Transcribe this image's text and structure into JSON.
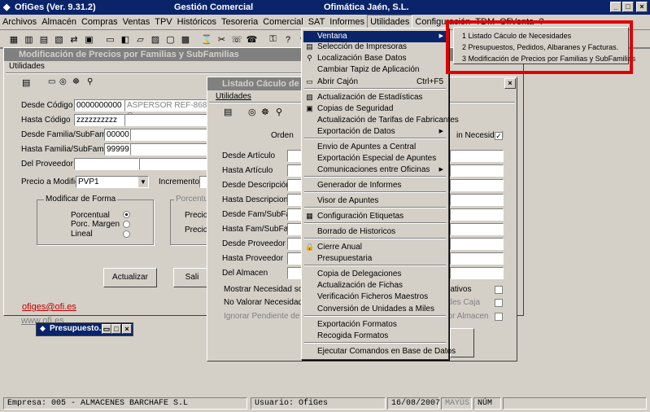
{
  "app": {
    "title": "OfiGes (Ver. 9.31.2)",
    "center_title": "Gestión Comercial",
    "company": "Ofimática Jaén, S.L."
  },
  "menubar": [
    "Archivos",
    "Almacén",
    "Compras",
    "Ventas",
    "TPV",
    "Históricos",
    "Tesoreria",
    "Comercial",
    "SAT",
    "Informes",
    "Utilidades",
    "Configuración",
    "TDM",
    "OfiVenta",
    "?"
  ],
  "menu_utilidades": [
    "Ventana",
    "Selección de Impresoras",
    "Localización Base Datos",
    "Cambiar Tapiz de Aplicación",
    "Abrir Cajón",
    "Actualización de Estadísticas",
    "Copias de Seguridad",
    "Actualización de Tarifas de Fabricantes",
    "Exportación de Datos",
    "Envio de Apuntes a Central",
    "Exportación Especial de Apuntes",
    "Comunicaciones entre Oficinas",
    "Generador de Informes",
    "Visor de Apuntes",
    "Configuración Etiquetas",
    "Borrado de Historicos",
    "Cierre Anual",
    "Presupuestaria",
    "Copia de Delegaciones",
    "Actualización de Fichas",
    "Verificación Ficheros Maestros",
    "Conversión de Unidades a Miles",
    "Exportación Formatos",
    "Recogida Formatos",
    "Ejecutar Comandos en Base de Datos"
  ],
  "abrir_shortcut": "Ctrl+F5",
  "submenu": [
    "1 Listado Cáculo de Necesidades",
    "2 Presupuestos, Pedidos, Albaranes y Facturas.",
    "3 Modificación de Precios por Familias y SubFamilias"
  ],
  "win1": {
    "title": "Modificación de Precios por Familias y SubFamilias",
    "menu": "Utilidades",
    "desde_codigo_label": "Desde Código",
    "desde_codigo": "0000000000",
    "desde_codigo_desc": "ASPERSOR REF-868 C",
    "hasta_codigo_label": "Hasta Código",
    "hasta_codigo": "zzzzzzzzzz",
    "desde_fam_label": "Desde Familia/SubFamilia",
    "desde_fam": "00000",
    "hasta_fam_label": "Hasta Familia/SubFamilia",
    "hasta_fam": "99999",
    "proveedor_label": "Del Proveedor",
    "precio_label": "Precio a Modificar",
    "precio_value": "PVP1",
    "incremento_label": "Incremento",
    "forma_label": "Modificar de Forma",
    "porcentual": "Porcentual",
    "porc_margen": "Porc. Margen",
    "lineal": "Lineal",
    "porcentual_grp": "Porcentual",
    "precio1": "Precio",
    "precio2": "Precio",
    "actualizar": "Actualizar",
    "salir": "Sali"
  },
  "win2": {
    "title": "Listado Cáculo de Necesi",
    "menu": "Utilidades",
    "orden": "Orden",
    "necesidad": "in Necesidad",
    "labels": [
      "Desde Artículo",
      "Hasta Artículo",
      "Desde Descripción",
      "Hasta Descripcion",
      "Desde Fam/SubFam",
      "Hasta Fam/SubFam",
      "Desde Proveedor",
      "Hasta Proveedor",
      "Del Almacen"
    ],
    "mostrar": "Mostrar Necesidad sobre S",
    "no_valorar": "No Valorar Necesidad",
    "ignorar": "Ignorar Pendiente de Servi",
    "right1": "mativos",
    "right2": "ades Caja",
    "right3": "por Almacen"
  },
  "links": {
    "email": "ofiges@ofi.es",
    "web": "www.ofi.es"
  },
  "mini": {
    "title": "Presupuesto..."
  },
  "status": {
    "empresa": "Empresa: 005 - ALMACENES BARCHAFE S.L",
    "usuario": "Usuario: OfiGes",
    "fecha": "16/08/2007",
    "mayus": "MAYÚS",
    "num": "NÚM"
  },
  "colors": {
    "title_bar": "#0a246a",
    "face": "#d4d0c8",
    "highlight_box": "#e00000",
    "link": "#c00000"
  }
}
